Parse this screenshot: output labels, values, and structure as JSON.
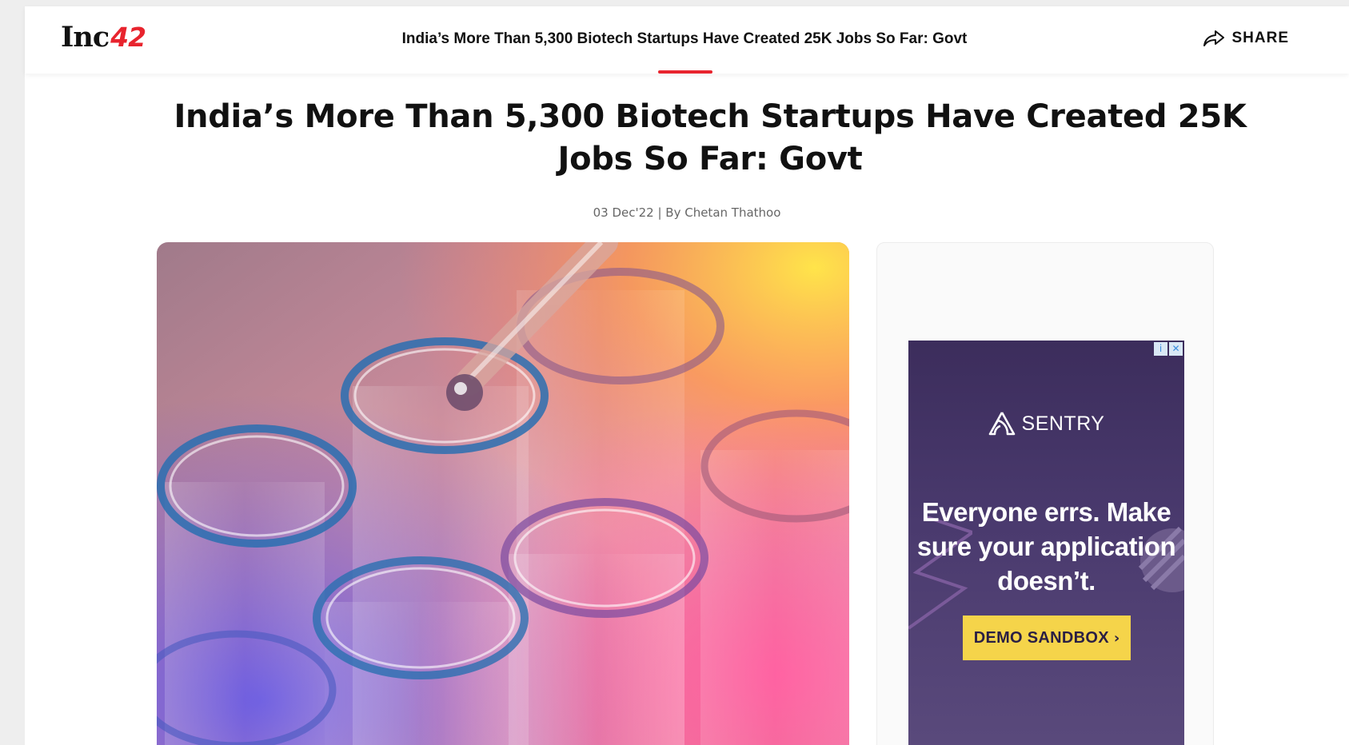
{
  "header": {
    "logo_text": "Inc",
    "logo_number": "42",
    "title": "India’s More Than 5,300 Biotech Startups Have Created 25K Jobs So Far: Govt",
    "share_label": "SHARE",
    "share_icon": "share-arrow-icon"
  },
  "article": {
    "title": "India’s More Than 5,300 Biotech Startups Have Created 25K Jobs So Far: Govt",
    "meta": "03 Dec'22 | By Chetan Thathoo",
    "hero_alt": "test-tubes-image"
  },
  "ad": {
    "info_badge": "i",
    "close_badge": "✕",
    "brand": "SENTRY",
    "headline": "Everyone errs. Make sure your application doesn’t.",
    "button_label": "DEMO SANDBOX",
    "button_chevron": "›"
  },
  "colors": {
    "accent": "#e8242e",
    "ad_background": "#3c2d5c",
    "ad_button": "#f5d44a"
  }
}
